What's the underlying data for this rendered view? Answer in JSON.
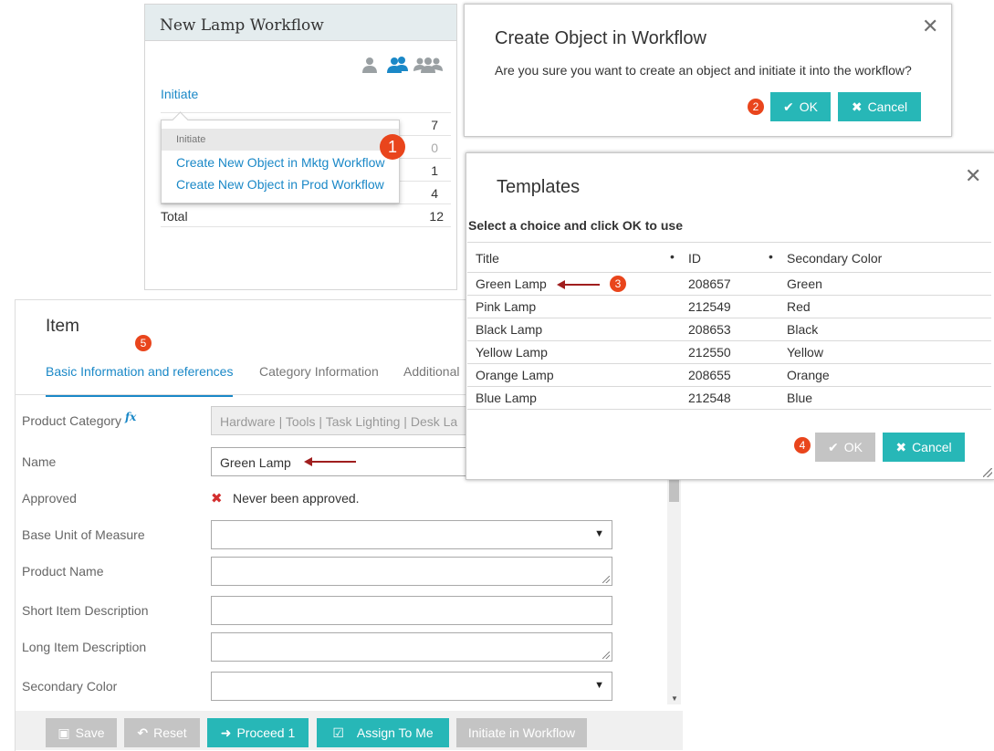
{
  "widget": {
    "title": "New Lamp Workflow",
    "initiate_link": "Initiate",
    "counts": [
      "7",
      "0",
      "1",
      "4"
    ],
    "total_label": "Total",
    "total_value": "12",
    "dropdown": {
      "header": "Initiate",
      "items": [
        "Create New Object in Mktg Workflow",
        "Create New Object in Prod Workflow"
      ]
    }
  },
  "confirm_dialog": {
    "title": "Create Object in Workflow",
    "message": "Are you sure you want to create an object and initiate it into the workflow?",
    "ok_label": "OK",
    "cancel_label": "Cancel"
  },
  "templates_dialog": {
    "title": "Templates",
    "instruction": "Select a choice and click OK to use",
    "columns": [
      "Title",
      "ID",
      "Secondary Color"
    ],
    "rows": [
      {
        "title": "Green Lamp",
        "id": "208657",
        "color": "Green"
      },
      {
        "title": "Pink Lamp",
        "id": "212549",
        "color": "Red"
      },
      {
        "title": "Black Lamp",
        "id": "208653",
        "color": "Black"
      },
      {
        "title": "Yellow Lamp",
        "id": "212550",
        "color": "Yellow"
      },
      {
        "title": "Orange Lamp",
        "id": "208655",
        "color": "Orange"
      },
      {
        "title": "Blue Lamp",
        "id": "212548",
        "color": "Blue"
      }
    ],
    "ok_label": "OK",
    "cancel_label": "Cancel"
  },
  "item_form": {
    "title": "Item",
    "tabs": [
      "Basic Information and references",
      "Category Information",
      "Additional"
    ],
    "fields": {
      "product_category_label": "Product Category",
      "product_category_fx": "fx",
      "product_category_value": "Hardware | Tools | Task Lighting | Desk La",
      "name_label": "Name",
      "name_value": "Green Lamp",
      "approved_label": "Approved",
      "approved_value": "Never been approved.",
      "base_uom_label": "Base Unit of Measure",
      "product_name_label": "Product Name",
      "short_desc_label": "Short Item Description",
      "long_desc_label": "Long Item Description",
      "secondary_color_label": "Secondary Color"
    },
    "buttons": {
      "save": "Save",
      "reset": "Reset",
      "proceed": "Proceed 1",
      "assign": "Assign To Me",
      "initiate": "Initiate in Workflow"
    }
  },
  "step_badges": [
    "1",
    "2",
    "3",
    "4",
    "5"
  ],
  "colors": {
    "teal": "#27b7b7",
    "link": "#1a88c7",
    "badge": "#e9451c",
    "arrow": "#a01e1e",
    "disabled": "#c4c4c4"
  }
}
